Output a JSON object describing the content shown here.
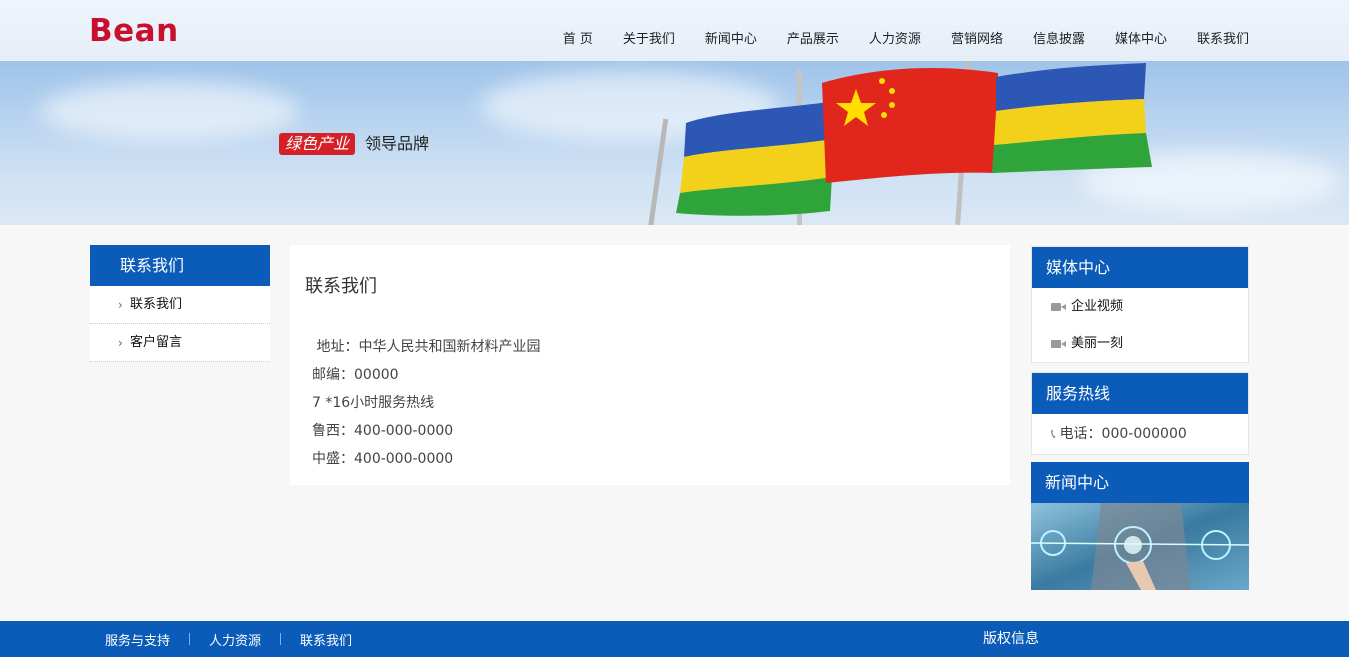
{
  "header": {
    "logo": "Bean",
    "nav": [
      "首 页",
      "关于我们",
      "新闻中心",
      "产品展示",
      "人力资源",
      "营销网络",
      "信息披露",
      "媒体中心",
      "联系我们"
    ]
  },
  "banner": {
    "slogan_tag": "绿色产业",
    "slogan_text": "领导品牌"
  },
  "left_sidebar": {
    "title": "联系我们",
    "items": [
      "联系我们",
      "客户留言"
    ]
  },
  "main": {
    "title": "联系我们",
    "lines": [
      " 地址：中华人民共和国新材料产业园",
      "邮编：00000",
      "7 *16小时服务热线",
      "鲁西：400-000-0000",
      "中盛：400-000-0000"
    ]
  },
  "right_sidebar": {
    "media": {
      "title": "媒体中心",
      "items": [
        "企业视频",
        "美丽一刻"
      ]
    },
    "hotline": {
      "title": "服务热线",
      "phone": "电话：000-000000"
    },
    "news": {
      "title": "新闻中心"
    }
  },
  "footer": {
    "links": [
      "服务与支持",
      "人力资源",
      "联系我们"
    ],
    "copyright": "版权信息"
  },
  "colors": {
    "primary": "#0a5cb8",
    "logo": "#c8102e",
    "slogan_tag": "#d42027",
    "background": "#f7f7f7"
  }
}
